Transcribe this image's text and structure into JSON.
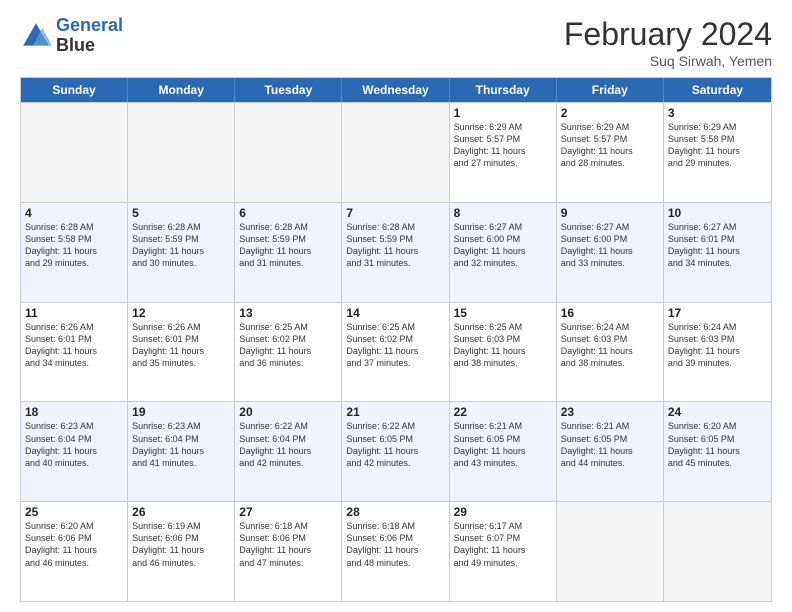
{
  "logo": {
    "line1": "General",
    "line2": "Blue"
  },
  "header": {
    "month": "February 2024",
    "location": "Suq Sirwah, Yemen"
  },
  "weekdays": [
    "Sunday",
    "Monday",
    "Tuesday",
    "Wednesday",
    "Thursday",
    "Friday",
    "Saturday"
  ],
  "rows": [
    {
      "alt": false,
      "cells": [
        {
          "date": "",
          "info": "",
          "empty": true
        },
        {
          "date": "",
          "info": "",
          "empty": true
        },
        {
          "date": "",
          "info": "",
          "empty": true
        },
        {
          "date": "",
          "info": "",
          "empty": true
        },
        {
          "date": "1",
          "info": "Sunrise: 6:29 AM\nSunset: 5:57 PM\nDaylight: 11 hours\nand 27 minutes."
        },
        {
          "date": "2",
          "info": "Sunrise: 6:29 AM\nSunset: 5:57 PM\nDaylight: 11 hours\nand 28 minutes."
        },
        {
          "date": "3",
          "info": "Sunrise: 6:29 AM\nSunset: 5:58 PM\nDaylight: 11 hours\nand 29 minutes."
        }
      ]
    },
    {
      "alt": true,
      "cells": [
        {
          "date": "4",
          "info": "Sunrise: 6:28 AM\nSunset: 5:58 PM\nDaylight: 11 hours\nand 29 minutes."
        },
        {
          "date": "5",
          "info": "Sunrise: 6:28 AM\nSunset: 5:59 PM\nDaylight: 11 hours\nand 30 minutes."
        },
        {
          "date": "6",
          "info": "Sunrise: 6:28 AM\nSunset: 5:59 PM\nDaylight: 11 hours\nand 31 minutes."
        },
        {
          "date": "7",
          "info": "Sunrise: 6:28 AM\nSunset: 5:59 PM\nDaylight: 11 hours\nand 31 minutes."
        },
        {
          "date": "8",
          "info": "Sunrise: 6:27 AM\nSunset: 6:00 PM\nDaylight: 11 hours\nand 32 minutes."
        },
        {
          "date": "9",
          "info": "Sunrise: 6:27 AM\nSunset: 6:00 PM\nDaylight: 11 hours\nand 33 minutes."
        },
        {
          "date": "10",
          "info": "Sunrise: 6:27 AM\nSunset: 6:01 PM\nDaylight: 11 hours\nand 34 minutes."
        }
      ]
    },
    {
      "alt": false,
      "cells": [
        {
          "date": "11",
          "info": "Sunrise: 6:26 AM\nSunset: 6:01 PM\nDaylight: 11 hours\nand 34 minutes."
        },
        {
          "date": "12",
          "info": "Sunrise: 6:26 AM\nSunset: 6:01 PM\nDaylight: 11 hours\nand 35 minutes."
        },
        {
          "date": "13",
          "info": "Sunrise: 6:25 AM\nSunset: 6:02 PM\nDaylight: 11 hours\nand 36 minutes."
        },
        {
          "date": "14",
          "info": "Sunrise: 6:25 AM\nSunset: 6:02 PM\nDaylight: 11 hours\nand 37 minutes."
        },
        {
          "date": "15",
          "info": "Sunrise: 6:25 AM\nSunset: 6:03 PM\nDaylight: 11 hours\nand 38 minutes."
        },
        {
          "date": "16",
          "info": "Sunrise: 6:24 AM\nSunset: 6:03 PM\nDaylight: 11 hours\nand 38 minutes."
        },
        {
          "date": "17",
          "info": "Sunrise: 6:24 AM\nSunset: 6:03 PM\nDaylight: 11 hours\nand 39 minutes."
        }
      ]
    },
    {
      "alt": true,
      "cells": [
        {
          "date": "18",
          "info": "Sunrise: 6:23 AM\nSunset: 6:04 PM\nDaylight: 11 hours\nand 40 minutes."
        },
        {
          "date": "19",
          "info": "Sunrise: 6:23 AM\nSunset: 6:04 PM\nDaylight: 11 hours\nand 41 minutes."
        },
        {
          "date": "20",
          "info": "Sunrise: 6:22 AM\nSunset: 6:04 PM\nDaylight: 11 hours\nand 42 minutes."
        },
        {
          "date": "21",
          "info": "Sunrise: 6:22 AM\nSunset: 6:05 PM\nDaylight: 11 hours\nand 42 minutes."
        },
        {
          "date": "22",
          "info": "Sunrise: 6:21 AM\nSunset: 6:05 PM\nDaylight: 11 hours\nand 43 minutes."
        },
        {
          "date": "23",
          "info": "Sunrise: 6:21 AM\nSunset: 6:05 PM\nDaylight: 11 hours\nand 44 minutes."
        },
        {
          "date": "24",
          "info": "Sunrise: 6:20 AM\nSunset: 6:05 PM\nDaylight: 11 hours\nand 45 minutes."
        }
      ]
    },
    {
      "alt": false,
      "cells": [
        {
          "date": "25",
          "info": "Sunrise: 6:20 AM\nSunset: 6:06 PM\nDaylight: 11 hours\nand 46 minutes."
        },
        {
          "date": "26",
          "info": "Sunrise: 6:19 AM\nSunset: 6:06 PM\nDaylight: 11 hours\nand 46 minutes."
        },
        {
          "date": "27",
          "info": "Sunrise: 6:18 AM\nSunset: 6:06 PM\nDaylight: 11 hours\nand 47 minutes."
        },
        {
          "date": "28",
          "info": "Sunrise: 6:18 AM\nSunset: 6:06 PM\nDaylight: 11 hours\nand 48 minutes."
        },
        {
          "date": "29",
          "info": "Sunrise: 6:17 AM\nSunset: 6:07 PM\nDaylight: 11 hours\nand 49 minutes."
        },
        {
          "date": "",
          "info": "",
          "empty": true
        },
        {
          "date": "",
          "info": "",
          "empty": true
        }
      ]
    }
  ]
}
